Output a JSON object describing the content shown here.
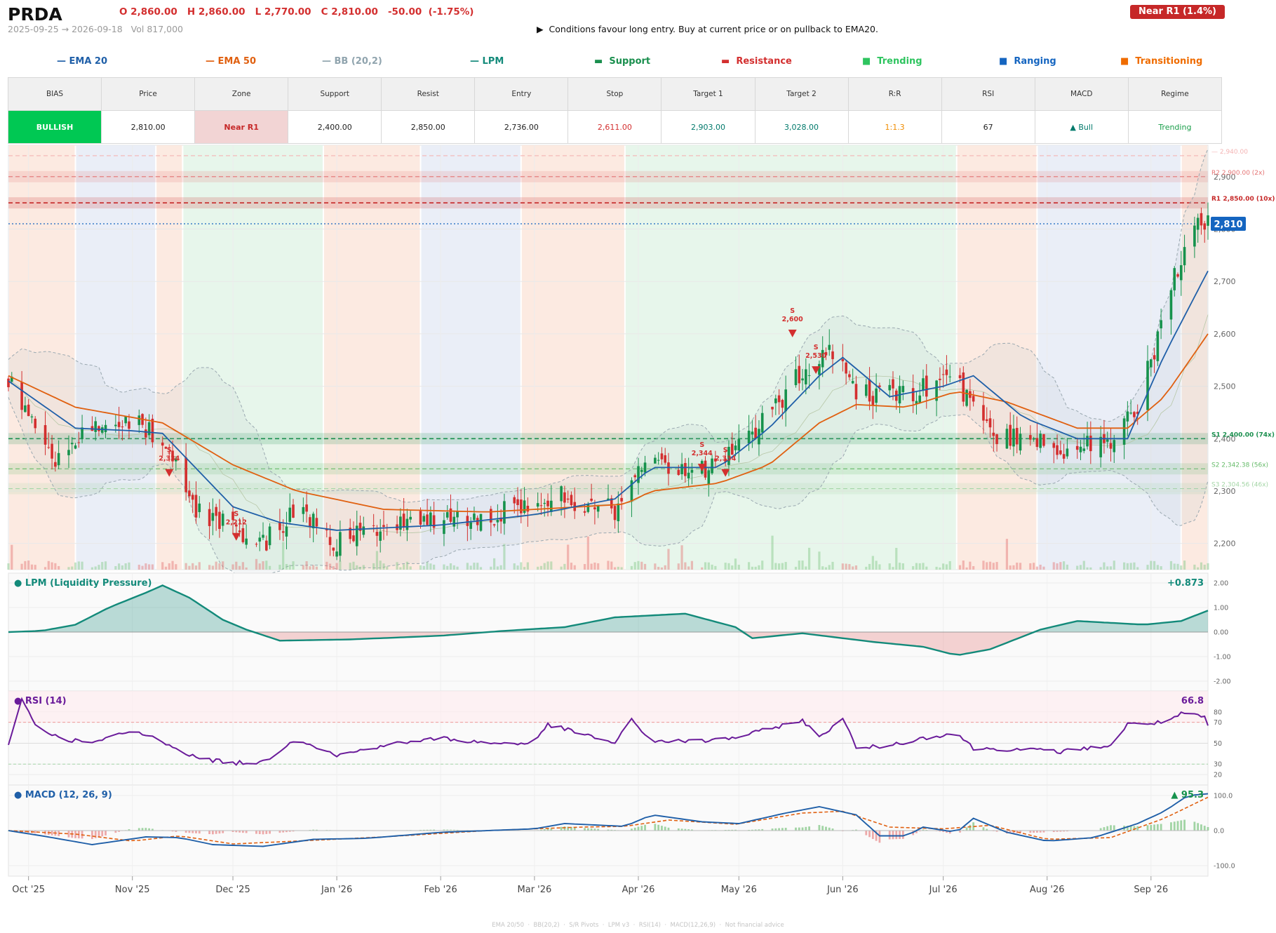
{
  "header": {
    "ticker": "PRDA",
    "ohlc": "O 2,860.00   H 2,860.00   L 2,770.00   C 2,810.00   -50.00  (-1.75%)",
    "date_range": "2025-09-25 → 2026-09-18",
    "volume": "Vol 817,000",
    "signal": "▶  Conditions favour long entry. Buy at current price or on pullback to EMA20.",
    "zone_badge": "Near R1  (1.4%)"
  },
  "legend": [
    {
      "label": "— EMA 20",
      "color": "#1f5fa8"
    },
    {
      "label": "— EMA 50",
      "color": "#e06010"
    },
    {
      "label": "— BB (20,2)",
      "color": "#90a4ae"
    },
    {
      "label": "— LPM",
      "color": "#138a7a"
    },
    {
      "label": "▬  Support",
      "color": "#1a8f4e"
    },
    {
      "label": "▬  Resistance",
      "color": "#d32f2f"
    },
    {
      "label": "■  Trending",
      "color": "#2ec45f"
    },
    {
      "label": "■  Ranging",
      "color": "#1565c0"
    },
    {
      "label": "■  Transitioning",
      "color": "#ef6c00"
    }
  ],
  "summary_table": {
    "headers": [
      "BIAS",
      "Price",
      "Zone",
      "Support",
      "Resist",
      "Entry",
      "Stop",
      "Target 1",
      "Target 2",
      "R:R",
      "RSI",
      "MACD",
      "Regime"
    ],
    "values": [
      "BULLISH",
      "2,810.00",
      "Near R1",
      "2,400.00",
      "2,850.00",
      "2,736.00",
      "2,611.00",
      "2,903.00",
      "3,028.00",
      "1:1.3",
      "67",
      "▲ Bull",
      "Trending"
    ],
    "colors": [
      "#ffffff",
      "#222222",
      "#c62828",
      "#222222",
      "#222222",
      "#222222",
      "#d32f2f",
      "#00796b",
      "#00796b",
      "#ef8c00",
      "#222222",
      "#00796b",
      "#1a9e4a"
    ],
    "backgrounds": [
      "#00c853",
      "#ffffff",
      "#f2d4d4",
      "#ffffff",
      "#ffffff",
      "#ffffff",
      "#ffffff",
      "#ffffff",
      "#ffffff",
      "#ffffff",
      "#ffffff",
      "#ffffff",
      "#ffffff"
    ]
  },
  "chart_data": {
    "type": "candlestick",
    "x_tick_labels": [
      "Oct '25",
      "Nov '25",
      "Dec '25",
      "Jan '26",
      "Feb '26",
      "Mar '26",
      "Apr '26",
      "May '26",
      "Jun '26",
      "Jul '26",
      "Aug '26",
      "Sep '26"
    ],
    "x_tick_dates": [
      "2025-10-01",
      "2025-11-01",
      "2025-12-01",
      "2026-01-01",
      "2026-02-01",
      "2026-03-01",
      "2026-04-01",
      "2026-05-01",
      "2026-06-01",
      "2026-07-01",
      "2026-08-01",
      "2026-09-01"
    ],
    "x_range": [
      "2025-09-25",
      "2026-09-18"
    ],
    "price_panel": {
      "y_ticks": [
        2200,
        2300,
        2400,
        2500,
        2600,
        2700,
        2800,
        2900
      ],
      "y_tick_labels": [
        "2,200",
        "2,300",
        "2,400",
        "2,500",
        "2,600",
        "2,700",
        "2,800",
        "2,900"
      ],
      "ylim": [
        2150,
        2960
      ],
      "last_price": 2810,
      "last_price_label": "2,810",
      "key_levels": [
        {
          "value": 2940,
          "label": "— 2,940.00",
          "color": "#f4b4b4"
        },
        {
          "value": 2900,
          "label": "R2 2,900.00 (2x)",
          "color": "#e57373"
        },
        {
          "value": 2850,
          "label": "R1 2,850.00 (10x)",
          "color": "#c62828"
        },
        {
          "value": 2400,
          "label": "S1 2,400.00 (74x)",
          "color": "#1a8f4e"
        },
        {
          "value": 2342.38,
          "label": "S2 2,342.38 (56x)",
          "color": "#66bb6a"
        },
        {
          "value": 2304.56,
          "label": "S3 2,304.56 (46x)",
          "color": "#a5d6a7"
        }
      ],
      "regimes": [
        {
          "start": "2025-09-25",
          "end": "2025-10-15",
          "type": "Transitioning"
        },
        {
          "start": "2025-10-15",
          "end": "2025-11-08",
          "type": "Ranging"
        },
        {
          "start": "2025-11-08",
          "end": "2025-11-16",
          "type": "Transitioning"
        },
        {
          "start": "2025-11-16",
          "end": "2025-12-28",
          "type": "Trending"
        },
        {
          "start": "2025-12-28",
          "end": "2026-01-26",
          "type": "Transitioning"
        },
        {
          "start": "2026-01-26",
          "end": "2026-02-25",
          "type": "Ranging"
        },
        {
          "start": "2026-02-25",
          "end": "2026-03-28",
          "type": "Transitioning"
        },
        {
          "start": "2026-03-28",
          "end": "2026-07-05",
          "type": "Trending"
        },
        {
          "start": "2026-07-05",
          "end": "2026-07-29",
          "type": "Transitioning"
        },
        {
          "start": "2026-07-29",
          "end": "2026-09-10",
          "type": "Ranging"
        },
        {
          "start": "2026-09-10",
          "end": "2026-09-18",
          "type": "Transitioning"
        }
      ],
      "sell_signals": [
        {
          "date": "2025-11-12",
          "price": 2334,
          "label": "S\n2,334"
        },
        {
          "date": "2025-12-02",
          "price": 2212,
          "label": "S\n2,212"
        },
        {
          "date": "2026-04-20",
          "price": 2344,
          "label": "S\n2,344"
        },
        {
          "date": "2026-04-27",
          "price": 2334,
          "label": "S\n2,334"
        },
        {
          "date": "2026-05-17",
          "price": 2600,
          "label": "S\n2,600"
        },
        {
          "date": "2026-05-24",
          "price": 2530,
          "label": "S\n2,530"
        }
      ],
      "close_anchors": [
        [
          "2025-09-25",
          2515
        ],
        [
          "2025-10-03",
          2420
        ],
        [
          "2025-10-10",
          2360
        ],
        [
          "2025-10-20",
          2420
        ],
        [
          "2025-11-01",
          2440
        ],
        [
          "2025-11-10",
          2400
        ],
        [
          "2025-11-20",
          2270
        ],
        [
          "2025-12-01",
          2230
        ],
        [
          "2025-12-10",
          2200
        ],
        [
          "2025-12-20",
          2265
        ],
        [
          "2026-01-01",
          2200
        ],
        [
          "2026-01-15",
          2230
        ],
        [
          "2026-02-01",
          2240
        ],
        [
          "2026-02-15",
          2255
        ],
        [
          "2026-03-01",
          2265
        ],
        [
          "2026-03-10",
          2290
        ],
        [
          "2026-03-25",
          2260
        ],
        [
          "2026-04-01",
          2350
        ],
        [
          "2026-04-20",
          2340
        ],
        [
          "2026-05-01",
          2380
        ],
        [
          "2026-05-10",
          2450
        ],
        [
          "2026-05-20",
          2525
        ],
        [
          "2026-05-31",
          2570
        ],
        [
          "2026-06-05",
          2480
        ],
        [
          "2026-06-15",
          2490
        ],
        [
          "2026-06-25",
          2495
        ],
        [
          "2026-07-05",
          2510
        ],
        [
          "2026-07-15",
          2410
        ],
        [
          "2026-07-25",
          2395
        ],
        [
          "2026-08-05",
          2380
        ],
        [
          "2026-08-18",
          2385
        ],
        [
          "2026-08-28",
          2460
        ],
        [
          "2026-09-05",
          2640
        ],
        [
          "2026-09-12",
          2790
        ],
        [
          "2026-09-18",
          2810
        ]
      ],
      "ema20_anchors": [
        [
          "2025-09-25",
          2510
        ],
        [
          "2025-10-15",
          2420
        ],
        [
          "2025-11-01",
          2415
        ],
        [
          "2025-11-10",
          2410
        ],
        [
          "2025-12-01",
          2270
        ],
        [
          "2025-12-15",
          2240
        ],
        [
          "2026-01-01",
          2225
        ],
        [
          "2026-02-01",
          2235
        ],
        [
          "2026-03-01",
          2255
        ],
        [
          "2026-03-25",
          2285
        ],
        [
          "2026-04-05",
          2345
        ],
        [
          "2026-04-25",
          2345
        ],
        [
          "2026-05-10",
          2420
        ],
        [
          "2026-05-25",
          2520
        ],
        [
          "2026-06-01",
          2555
        ],
        [
          "2026-06-15",
          2480
        ],
        [
          "2026-07-01",
          2500
        ],
        [
          "2026-07-10",
          2520
        ],
        [
          "2026-07-25",
          2440
        ],
        [
          "2026-08-10",
          2400
        ],
        [
          "2026-08-25",
          2400
        ],
        [
          "2026-09-05",
          2560
        ],
        [
          "2026-09-18",
          2720
        ]
      ],
      "ema50_anchors": [
        [
          "2025-09-25",
          2520
        ],
        [
          "2025-10-15",
          2460
        ],
        [
          "2025-11-10",
          2430
        ],
        [
          "2025-12-01",
          2350
        ],
        [
          "2025-12-20",
          2300
        ],
        [
          "2026-01-15",
          2265
        ],
        [
          "2026-02-15",
          2260
        ],
        [
          "2026-03-15",
          2270
        ],
        [
          "2026-03-28",
          2275
        ],
        [
          "2026-04-05",
          2300
        ],
        [
          "2026-04-25",
          2315
        ],
        [
          "2026-05-10",
          2350
        ],
        [
          "2026-05-25",
          2430
        ],
        [
          "2026-06-05",
          2465
        ],
        [
          "2026-06-20",
          2460
        ],
        [
          "2026-07-05",
          2490
        ],
        [
          "2026-07-20",
          2470
        ],
        [
          "2026-08-10",
          2420
        ],
        [
          "2026-08-25",
          2420
        ],
        [
          "2026-09-05",
          2480
        ],
        [
          "2026-09-18",
          2600
        ]
      ]
    },
    "lpm_panel": {
      "title": "● LPM (Liquidity Pressure)",
      "last_value_label": "+0.873",
      "y_ticks": [
        -2,
        -1,
        0,
        1,
        2
      ],
      "y_tick_labels": [
        "-2.00",
        "-1.00",
        "0.00",
        "1.00",
        "2.00"
      ],
      "ylim": [
        -2.4,
        2.4
      ],
      "anchors": [
        [
          "2025-09-25",
          0.0
        ],
        [
          "2025-10-05",
          0.05
        ],
        [
          "2025-10-15",
          0.3
        ],
        [
          "2025-10-25",
          1.0
        ],
        [
          "2025-11-05",
          1.6
        ],
        [
          "2025-11-10",
          1.9
        ],
        [
          "2025-11-18",
          1.4
        ],
        [
          "2025-11-28",
          0.5
        ],
        [
          "2025-12-05",
          0.1
        ],
        [
          "2025-12-15",
          -0.35
        ],
        [
          "2026-01-05",
          -0.3
        ],
        [
          "2026-02-01",
          -0.15
        ],
        [
          "2026-02-20",
          0.05
        ],
        [
          "2026-03-10",
          0.2
        ],
        [
          "2026-03-25",
          0.6
        ],
        [
          "2026-04-15",
          0.75
        ],
        [
          "2026-04-30",
          0.2
        ],
        [
          "2026-05-05",
          -0.25
        ],
        [
          "2026-05-20",
          -0.05
        ],
        [
          "2026-06-10",
          -0.4
        ],
        [
          "2026-06-25",
          -0.6
        ],
        [
          "2026-07-05",
          -0.95
        ],
        [
          "2026-07-15",
          -0.7
        ],
        [
          "2026-07-30",
          0.1
        ],
        [
          "2026-08-10",
          0.45
        ],
        [
          "2026-08-30",
          0.3
        ],
        [
          "2026-09-10",
          0.45
        ],
        [
          "2026-09-18",
          0.873
        ]
      ]
    },
    "rsi_panel": {
      "title": "● RSI (14)",
      "last_value_label": "66.8",
      "y_ticks": [
        20,
        30,
        50,
        70,
        80
      ],
      "y_tick_labels": [
        "20",
        "30",
        "50",
        "70",
        "80"
      ],
      "ylim": [
        10,
        100
      ],
      "overbought": 70,
      "oversold": 30,
      "anchors": [
        [
          "2025-09-25",
          50
        ],
        [
          "2025-09-29",
          92
        ],
        [
          "2025-10-03",
          68
        ],
        [
          "2025-10-10",
          55
        ],
        [
          "2025-10-20",
          50
        ],
        [
          "2025-11-01",
          62
        ],
        [
          "2025-11-10",
          52
        ],
        [
          "2025-11-20",
          36
        ],
        [
          "2025-12-01",
          31
        ],
        [
          "2025-12-10",
          32
        ],
        [
          "2025-12-20",
          55
        ],
        [
          "2026-01-01",
          38
        ],
        [
          "2026-01-15",
          48
        ],
        [
          "2026-02-01",
          55
        ],
        [
          "2026-02-15",
          50
        ],
        [
          "2026-03-01",
          50
        ],
        [
          "2026-03-05",
          68
        ],
        [
          "2026-03-25",
          50
        ],
        [
          "2026-03-30",
          72
        ],
        [
          "2026-04-05",
          52
        ],
        [
          "2026-04-20",
          52
        ],
        [
          "2026-05-01",
          56
        ],
        [
          "2026-05-15",
          68
        ],
        [
          "2026-05-20",
          72
        ],
        [
          "2026-05-25",
          55
        ],
        [
          "2026-06-01",
          75
        ],
        [
          "2026-06-05",
          45
        ],
        [
          "2026-06-15",
          48
        ],
        [
          "2026-06-25",
          55
        ],
        [
          "2026-07-05",
          60
        ],
        [
          "2026-07-10",
          45
        ],
        [
          "2026-07-25",
          44
        ],
        [
          "2026-08-05",
          42
        ],
        [
          "2026-08-20",
          48
        ],
        [
          "2026-08-25",
          68
        ],
        [
          "2026-09-05",
          70
        ],
        [
          "2026-09-10",
          78
        ],
        [
          "2026-09-17",
          75
        ],
        [
          "2026-09-18",
          66.8
        ]
      ]
    },
    "macd_panel": {
      "title": "● MACD (12, 26, 9)",
      "last_value_label": "▲ 95.3",
      "y_ticks": [
        -100,
        0,
        100
      ],
      "y_tick_labels": [
        "-100.0",
        "0.0",
        "100.0"
      ],
      "ylim": [
        -130,
        130
      ],
      "macd_anchors": [
        [
          "2025-09-25",
          0
        ],
        [
          "2025-10-05",
          -15
        ],
        [
          "2025-10-20",
          -40
        ],
        [
          "2025-11-05",
          -18
        ],
        [
          "2025-11-15",
          -20
        ],
        [
          "2025-11-25",
          -40
        ],
        [
          "2025-12-10",
          -45
        ],
        [
          "2025-12-25",
          -25
        ],
        [
          "2026-01-10",
          -22
        ],
        [
          "2026-02-01",
          -5
        ],
        [
          "2026-03-01",
          5
        ],
        [
          "2026-03-10",
          20
        ],
        [
          "2026-03-28",
          12
        ],
        [
          "2026-04-05",
          45
        ],
        [
          "2026-04-20",
          25
        ],
        [
          "2026-05-01",
          20
        ],
        [
          "2026-05-15",
          50
        ],
        [
          "2026-05-25",
          68
        ],
        [
          "2026-06-05",
          45
        ],
        [
          "2026-06-12",
          -15
        ],
        [
          "2026-06-20",
          -15
        ],
        [
          "2026-06-25",
          10
        ],
        [
          "2026-07-05",
          -5
        ],
        [
          "2026-07-10",
          35
        ],
        [
          "2026-07-20",
          -5
        ],
        [
          "2026-08-01",
          -30
        ],
        [
          "2026-08-15",
          -20
        ],
        [
          "2026-08-28",
          20
        ],
        [
          "2026-09-05",
          55
        ],
        [
          "2026-09-12",
          100
        ],
        [
          "2026-09-18",
          105
        ]
      ],
      "signal_anchors": [
        [
          "2025-09-25",
          0
        ],
        [
          "2025-10-15",
          -10
        ],
        [
          "2025-11-01",
          -30
        ],
        [
          "2025-11-15",
          -15
        ],
        [
          "2025-12-01",
          -38
        ],
        [
          "2025-12-20",
          -30
        ],
        [
          "2026-01-15",
          -18
        ],
        [
          "2026-02-15",
          0
        ],
        [
          "2026-03-15",
          10
        ],
        [
          "2026-03-28",
          12
        ],
        [
          "2026-04-10",
          30
        ],
        [
          "2026-04-30",
          18
        ],
        [
          "2026-05-20",
          50
        ],
        [
          "2026-06-01",
          55
        ],
        [
          "2026-06-15",
          10
        ],
        [
          "2026-07-01",
          5
        ],
        [
          "2026-07-15",
          15
        ],
        [
          "2026-08-01",
          -25
        ],
        [
          "2026-08-20",
          -20
        ],
        [
          "2026-09-05",
          35
        ],
        [
          "2026-09-18",
          95
        ]
      ]
    },
    "volume_label": "Vol 817,000"
  },
  "footnote": "EMA 20/50  ·  BB(20,2)  ·  S/R Pivots  ·  LPM v3  ·  RSI(14)  ·  MACD(12,26,9)  ·  Not financial advice"
}
